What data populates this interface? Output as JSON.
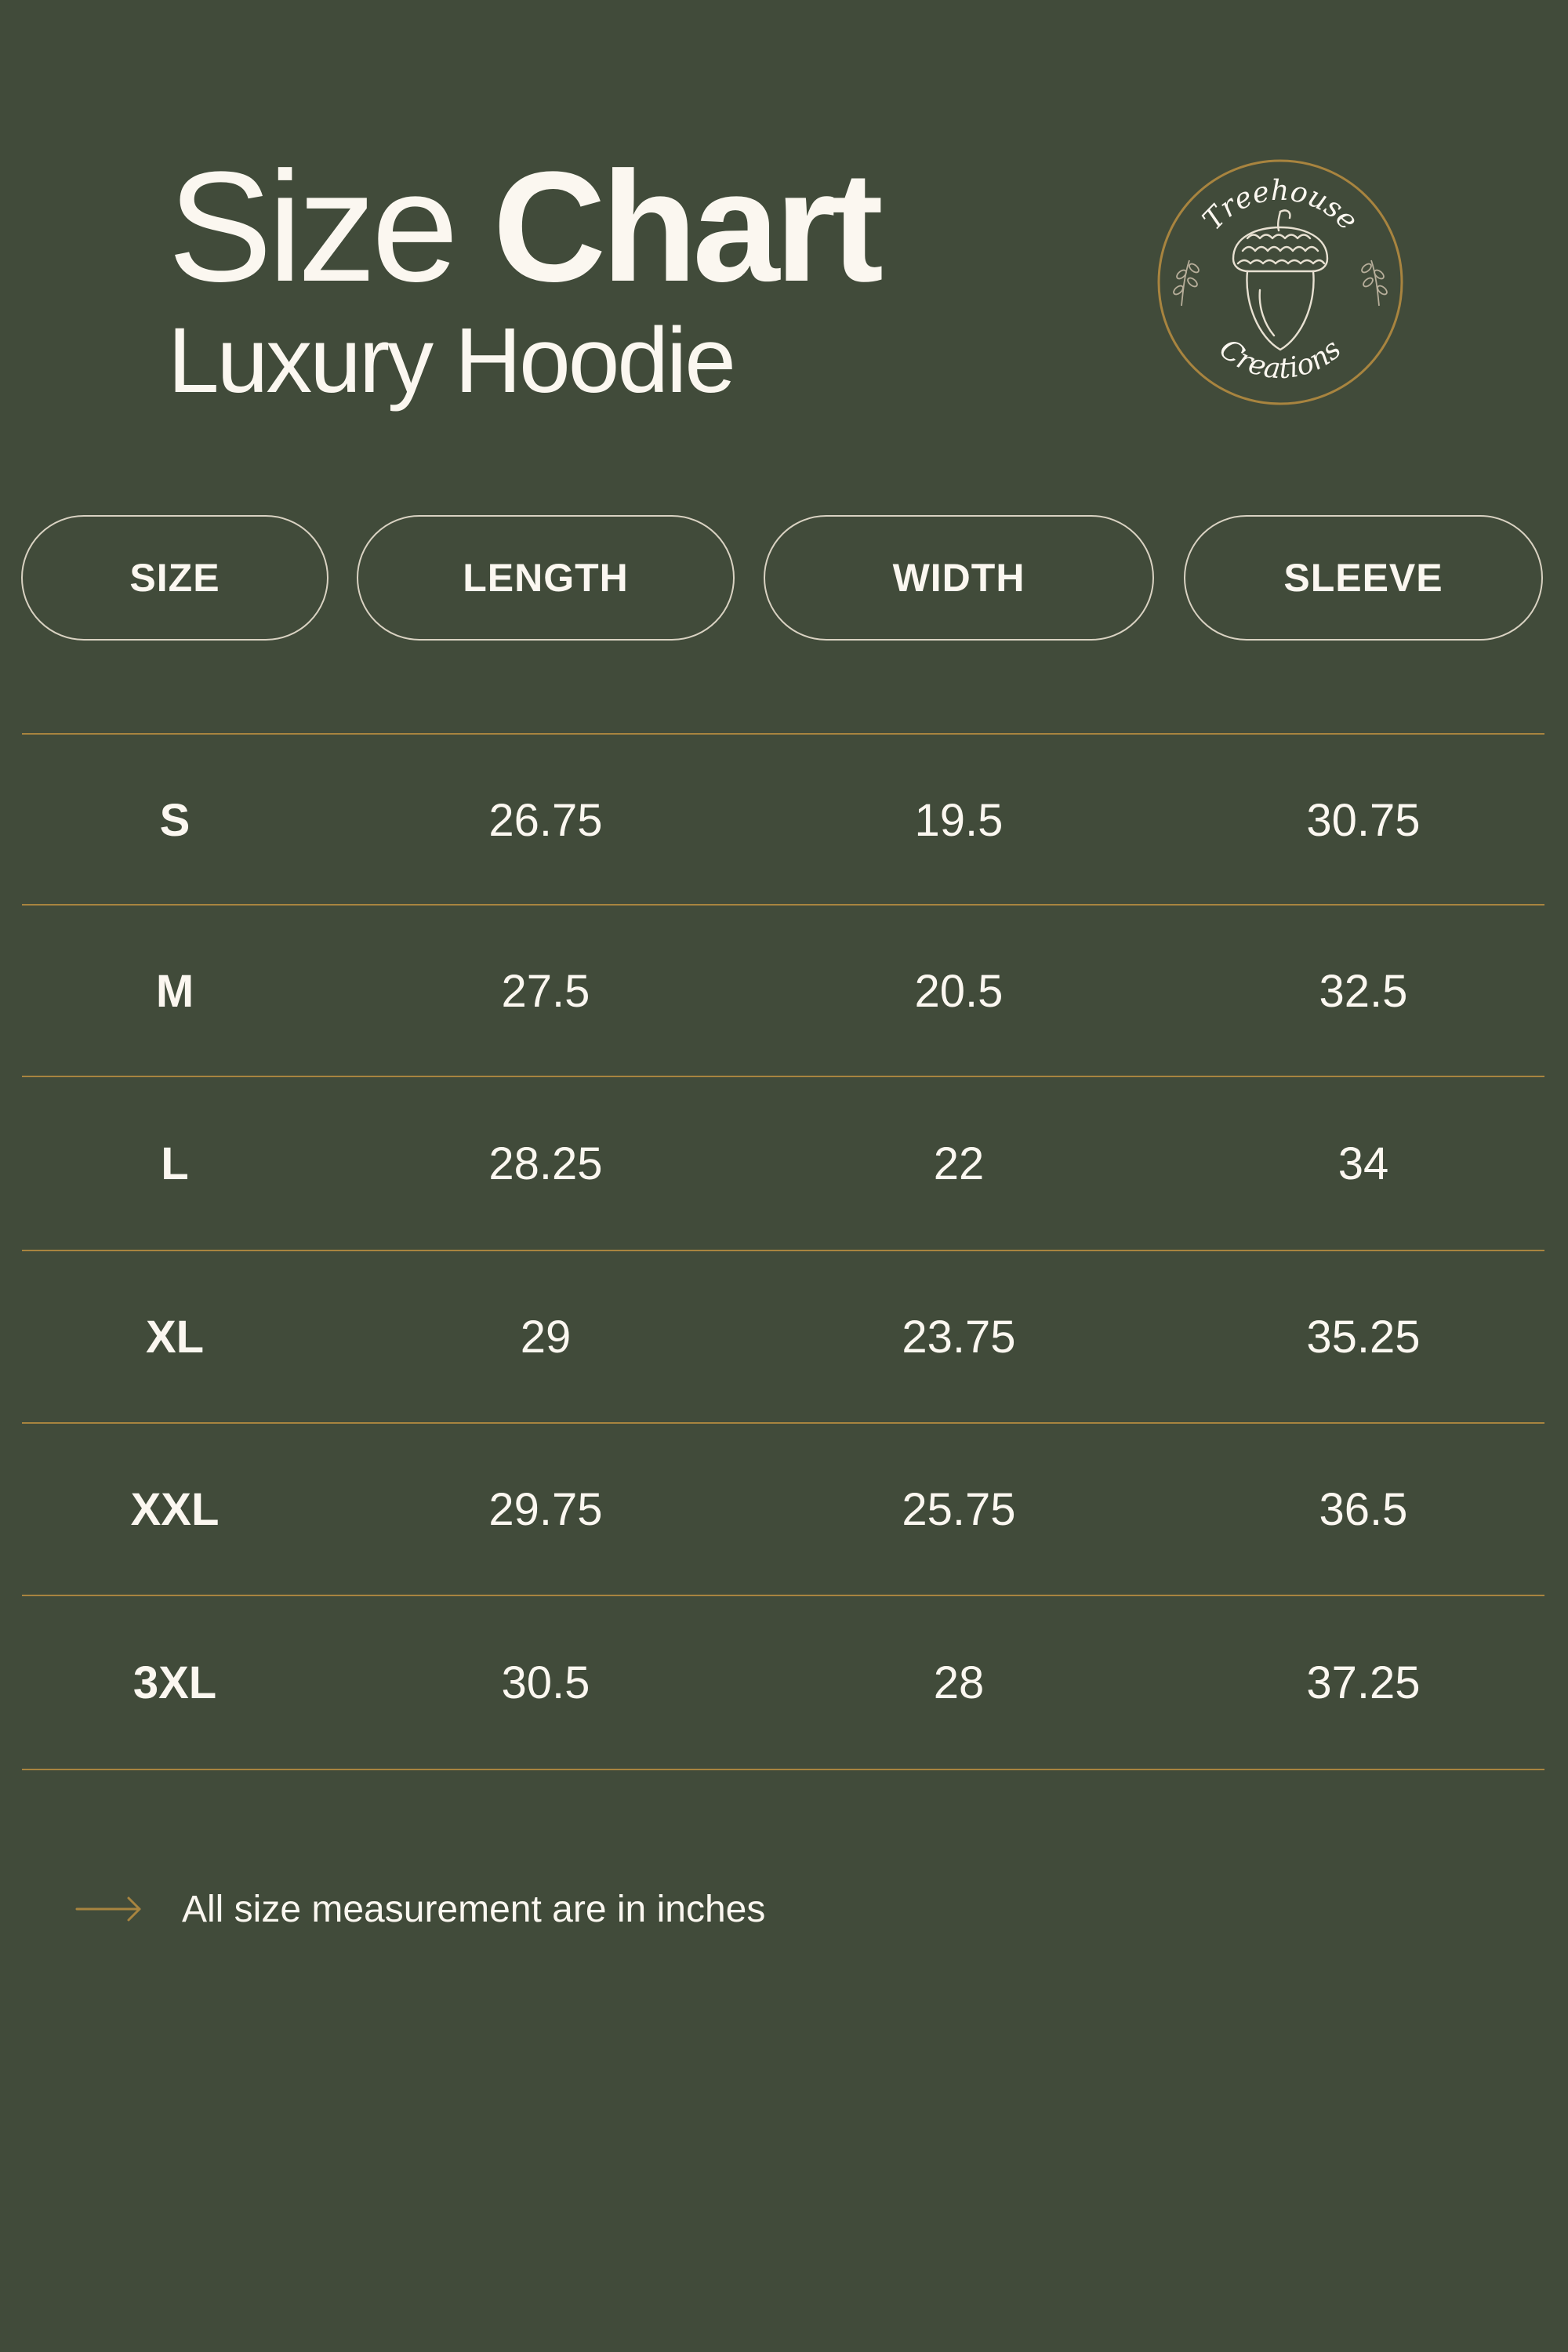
{
  "header": {
    "title_regular": "Size",
    "title_bold": "Chart",
    "subtitle": "Luxury Hoodie"
  },
  "logo": {
    "top_text": "Treehouse",
    "bottom_text": "Creations",
    "icon": "acorn-icon"
  },
  "table": {
    "columns": [
      "SIZE",
      "LENGTH",
      "WIDTH",
      "SLEEVE"
    ],
    "rows": [
      {
        "size": "S",
        "length": "26.75",
        "width": "19.5",
        "sleeve": "30.75"
      },
      {
        "size": "M",
        "length": "27.5",
        "width": "20.5",
        "sleeve": "32.5"
      },
      {
        "size": "L",
        "length": "28.25",
        "width": "22",
        "sleeve": "34"
      },
      {
        "size": "XL",
        "length": "29",
        "width": "23.75",
        "sleeve": "35.25"
      },
      {
        "size": "XXL",
        "length": "29.75",
        "width": "25.75",
        "sleeve": "36.5"
      },
      {
        "size": "3XL",
        "length": "30.5",
        "width": "28",
        "sleeve": "37.25"
      }
    ]
  },
  "footnote": {
    "icon": "arrow-right-icon",
    "text": "All size measurement are in inches"
  },
  "colors": {
    "background": "#414b3a",
    "text": "#fbf7f0",
    "accent_gold": "#a8843f",
    "pill_border": "#d9d2c2"
  }
}
